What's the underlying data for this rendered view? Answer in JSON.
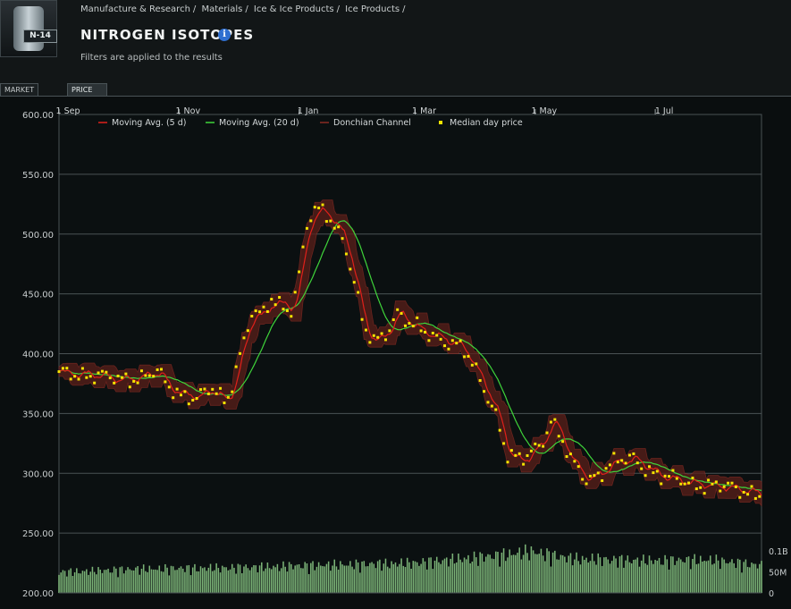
{
  "breadcrumb": [
    "Manufacture & Research",
    "Materials",
    "Ice & Ice Products",
    "Ice Products"
  ],
  "breadcrumb_sep": "/",
  "item_icon_label": "N-14",
  "title": "NITROGEN ISOTOPES",
  "info_icon": "info-icon",
  "filter_note": "Filters are applied to the results",
  "tabs": [
    {
      "label": "MARKET DATA",
      "active": false
    },
    {
      "label": "PRICE HISTORY",
      "active": true
    }
  ],
  "colors": {
    "background": "#0a0e0f",
    "ma5": "#e0201a",
    "ma20": "#3fd43a",
    "donchian_fill": "#5a1f1a",
    "donchian_edge": "#8a2a22",
    "median": "#f5e400",
    "volume": "#8fd08a",
    "grid": "#4a5254"
  },
  "chart_data": {
    "type": "line",
    "title": "",
    "xlabel": "",
    "ylabel": "",
    "x_tick_labels": [
      "1 Sep",
      "1 Nov",
      "1 Jan",
      "1 Mar",
      "1 May",
      "1 Jul"
    ],
    "x_tick_days": [
      0,
      61,
      122,
      181,
      242,
      303
    ],
    "x_range_days": [
      0,
      357
    ],
    "ylim": [
      200,
      600
    ],
    "y_ticks": [
      200,
      250,
      300,
      350,
      400,
      450,
      500,
      550,
      600
    ],
    "y_tick_labels": [
      "200.00",
      "250.00",
      "300.00",
      "350.00",
      "400.00",
      "450.00",
      "500.00",
      "550.00",
      "600.00"
    ],
    "volume_axis_labels": [
      "0.1B",
      "50M",
      "0"
    ],
    "volume_axis_values": [
      100000000,
      50000000,
      0
    ],
    "volume_max": 125000000,
    "legend": [
      {
        "label": "Moving Avg. (5 d)",
        "key": "ma5"
      },
      {
        "label": "Moving Avg. (20 d)",
        "key": "ma20"
      },
      {
        "label": "Donchian Channel",
        "key": "donchian"
      },
      {
        "label": "Median day price",
        "key": "median"
      }
    ],
    "legend_position": "top",
    "grid": true,
    "median_anchors": [
      [
        0,
        383
      ],
      [
        10,
        383
      ],
      [
        20,
        382
      ],
      [
        30,
        378
      ],
      [
        40,
        380
      ],
      [
        50,
        385
      ],
      [
        55,
        372
      ],
      [
        62,
        366
      ],
      [
        70,
        364
      ],
      [
        78,
        370
      ],
      [
        85,
        358
      ],
      [
        92,
        400
      ],
      [
        98,
        435
      ],
      [
        103,
        430
      ],
      [
        108,
        445
      ],
      [
        113,
        440
      ],
      [
        118,
        438
      ],
      [
        122,
        465
      ],
      [
        125,
        500
      ],
      [
        128,
        515
      ],
      [
        133,
        520
      ],
      [
        137,
        515
      ],
      [
        141,
        505
      ],
      [
        145,
        495
      ],
      [
        150,
        460
      ],
      [
        155,
        420
      ],
      [
        160,
        410
      ],
      [
        165,
        415
      ],
      [
        172,
        435
      ],
      [
        178,
        425
      ],
      [
        185,
        418
      ],
      [
        195,
        412
      ],
      [
        205,
        405
      ],
      [
        215,
        375
      ],
      [
        222,
        350
      ],
      [
        228,
        315
      ],
      [
        235,
        310
      ],
      [
        240,
        318
      ],
      [
        245,
        325
      ],
      [
        250,
        345
      ],
      [
        255,
        330
      ],
      [
        260,
        310
      ],
      [
        268,
        295
      ],
      [
        275,
        300
      ],
      [
        280,
        308
      ],
      [
        285,
        310
      ],
      [
        292,
        312
      ],
      [
        298,
        305
      ],
      [
        305,
        298
      ],
      [
        312,
        295
      ],
      [
        320,
        292
      ],
      [
        330,
        290
      ],
      [
        340,
        288
      ],
      [
        350,
        285
      ],
      [
        357,
        282
      ]
    ],
    "volume_anchors": [
      [
        0,
        45000000
      ],
      [
        40,
        52000000
      ],
      [
        90,
        55000000
      ],
      [
        130,
        60000000
      ],
      [
        180,
        65000000
      ],
      [
        220,
        80000000
      ],
      [
        240,
        90000000
      ],
      [
        260,
        75000000
      ],
      [
        300,
        70000000
      ],
      [
        330,
        72000000
      ],
      [
        357,
        60000000
      ]
    ]
  }
}
